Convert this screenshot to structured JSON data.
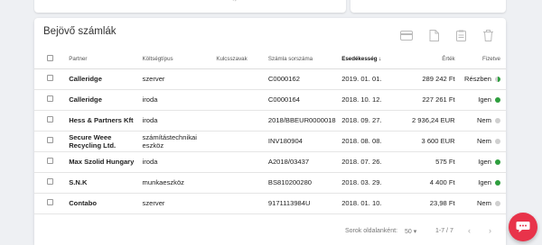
{
  "card": {
    "title": "Bejövő számlák"
  },
  "columns": {
    "partner": "Partner",
    "type": "Költségtípus",
    "keywords": "Kulcsszavak",
    "number": "Számla sorszáma",
    "due": "Esedékesség",
    "value": "Érték",
    "paid": "Fizetve"
  },
  "rows": [
    {
      "partner": "Calleridge",
      "type": "szerver",
      "number": "C0000162",
      "due": "2019. 01. 01.",
      "value": "289 242 Ft",
      "paid": "Részben",
      "status": "partial"
    },
    {
      "partner": "Calleridge",
      "type": "iroda",
      "number": "C0000164",
      "due": "2018. 10. 12.",
      "value": "227 261 Ft",
      "paid": "Igen",
      "status": "yes"
    },
    {
      "partner": "Hess & Partners Kft",
      "type": "iroda",
      "number": "2018/BBEUR0000018",
      "due": "2018. 09. 27.",
      "value": "2 936,24 EUR",
      "paid": "Nem",
      "status": "no"
    },
    {
      "partner": "Secure Weee Recycling Ltd.",
      "type": "számítástechnikai eszköz",
      "number": "INV180904",
      "due": "2018. 08. 08.",
      "value": "3 600 EUR",
      "paid": "Nem",
      "status": "no"
    },
    {
      "partner": "Max Szolid Hungary",
      "type": "iroda",
      "number": "A2018/03437",
      "due": "2018. 07. 26.",
      "value": "575 Ft",
      "paid": "Igen",
      "status": "yes"
    },
    {
      "partner": "S.N.K",
      "type": "munkaeszköz",
      "number": "BS810200280",
      "due": "2018. 03. 29.",
      "value": "4 400 Ft",
      "paid": "Igen",
      "status": "yes"
    },
    {
      "partner": "Contabo",
      "type": "szerver",
      "number": "9171113984U",
      "due": "2018. 01. 10.",
      "value": "23,98 Ft",
      "paid": "Nem",
      "status": "no"
    }
  ],
  "footer": {
    "rows_per_page_label": "Sorok oldalanként:",
    "rows_per_page": "50",
    "range": "1-7 / 7"
  },
  "icons": {
    "toolbar": [
      "credit-card-icon",
      "document-icon",
      "clipboard-icon",
      "trash-icon"
    ],
    "chat": "chat-bubble-icon"
  },
  "colors": {
    "paid_yes": "#2e9e3e",
    "paid_no": "#cfcfcf",
    "chat": "#e8334a"
  }
}
